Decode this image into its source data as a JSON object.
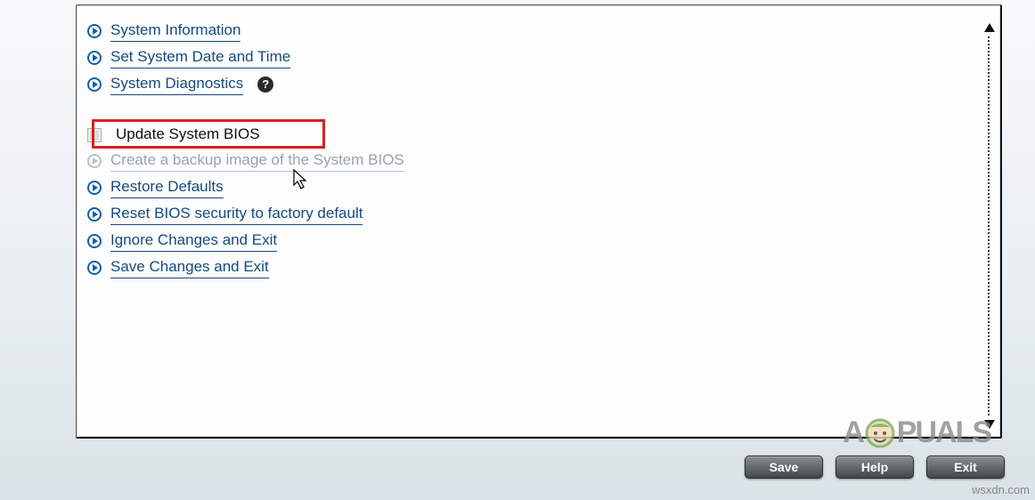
{
  "menu": {
    "items": [
      {
        "label": "System Information",
        "type": "link"
      },
      {
        "label": "Set System Date and Time",
        "type": "link"
      },
      {
        "label": "System Diagnostics",
        "type": "link",
        "help": true
      },
      {
        "label": "Update System BIOS",
        "type": "selected"
      },
      {
        "label": "Create a backup image of the System BIOS",
        "type": "disabled"
      },
      {
        "label": "Restore Defaults",
        "type": "link"
      },
      {
        "label": "Reset BIOS security to factory default",
        "type": "link"
      },
      {
        "label": "Ignore Changes and Exit",
        "type": "link"
      },
      {
        "label": "Save Changes and Exit",
        "type": "link"
      }
    ]
  },
  "footer": {
    "save": "Save",
    "help": "Help",
    "exit": "Exit"
  },
  "watermark": {
    "brand_left": "A",
    "brand_right": "PUALS",
    "domain": "wsxdn.com"
  }
}
